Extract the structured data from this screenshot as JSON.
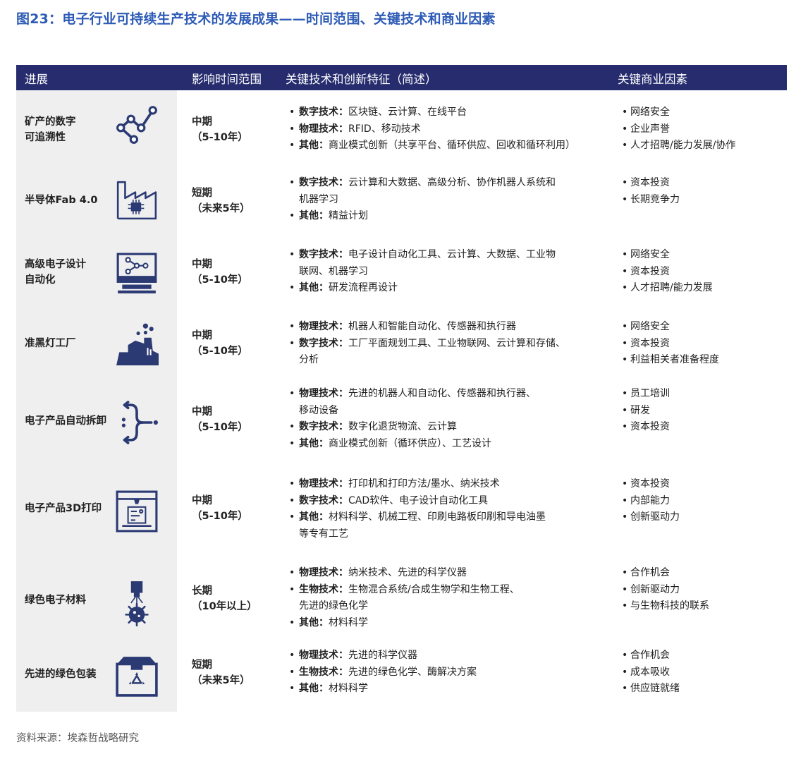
{
  "title": "图23：电子行业可持续生产技术的发展成果——时间范围、关键技术和商业因素",
  "header": {
    "col1": "进展",
    "col2": "影响时间范围",
    "col3": "关键技术和创新特征（简述）",
    "col4": "关键商业因素"
  },
  "rows": [
    {
      "name_l1": "矿产的数字",
      "name_l2": "可追溯性",
      "icon": "traceability-nodes-icon",
      "time_l1": "中期",
      "time_l2": "（5-10年）",
      "tech": [
        {
          "label": "数字技术：",
          "l1": "区块链、云计算、在线平台",
          "l2": ""
        },
        {
          "label": "物理技术：",
          "l1": "RFID、移动技术",
          "l2": ""
        },
        {
          "label": "其他：",
          "l1": "商业模式创新（共享平台、循环供应、回收和循环利用）",
          "l2": ""
        }
      ],
      "biz": [
        "网络安全",
        "企业声誉",
        "人才招聘/能力发展/协作"
      ]
    },
    {
      "name_l1": "半导体Fab 4.0",
      "name_l2": "",
      "icon": "factory-chip-icon",
      "time_l1": "短期",
      "time_l2": "（未来5年）",
      "tech": [
        {
          "label": "数字技术：",
          "l1": "云计算和大数据、高级分析、协作机器人系统和",
          "l2": "机器学习"
        },
        {
          "label": "其他：",
          "l1": "精益计划",
          "l2": ""
        }
      ],
      "biz": [
        "资本投资",
        "长期竞争力"
      ]
    },
    {
      "name_l1": "高级电子设计",
      "name_l2": "自动化",
      "icon": "monitor-network-icon",
      "time_l1": "中期",
      "time_l2": "（5-10年）",
      "tech": [
        {
          "label": "数字技术：",
          "l1": "电子设计自动化工具、云计算、大数据、工业物",
          "l2": "联网、机器学习"
        },
        {
          "label": "其他：",
          "l1": "研发流程再设计",
          "l2": ""
        }
      ],
      "biz": [
        "网络安全",
        "资本投资",
        "人才招聘/能力发展"
      ]
    },
    {
      "name_l1": "准黑灯工厂",
      "name_l2": "",
      "icon": "dark-factory-icon",
      "time_l1": "中期",
      "time_l2": "（5-10年）",
      "tech": [
        {
          "label": "物理技术：",
          "l1": "机器人和智能自动化、传感器和执行器",
          "l2": ""
        },
        {
          "label": "数字技术：",
          "l1": "工厂平面规划工具、工业物联网、云计算和存储、",
          "l2": "分析"
        }
      ],
      "biz": [
        "网络安全",
        "资本投资",
        "利益相关者准备程度"
      ]
    },
    {
      "name_l1": "电子产品自动拆卸",
      "name_l2": "",
      "icon": "disassembly-arrows-icon",
      "time_l1": "中期",
      "time_l2": "（5-10年）",
      "tech": [
        {
          "label": "物理技术：",
          "l1": "先进的机器人和自动化、传感器和执行器、",
          "l2": "移动设备"
        },
        {
          "label": "数字技术：",
          "l1": "数字化退货物流、云计算",
          "l2": ""
        },
        {
          "label": "其他：",
          "l1": "商业模式创新（循环供应）、工艺设计",
          "l2": ""
        }
      ],
      "biz": [
        "员工培训",
        "研发",
        "资本投资"
      ]
    },
    {
      "name_l1": "电子产品3D打印",
      "name_l2": "",
      "icon": "3d-printer-icon",
      "time_l1": "中期",
      "time_l2": "（5-10年）",
      "tech": [
        {
          "label": "物理技术：",
          "l1": "打印机和打印方法/墨水、纳米技术",
          "l2": ""
        },
        {
          "label": "数字技术：",
          "l1": "CAD软件、电子设计自动化工具",
          "l2": ""
        },
        {
          "label": "其他：",
          "l1": "材料科学、机械工程、印刷电路板印刷和导电油墨",
          "l2": "等专有工艺"
        }
      ],
      "biz": [
        "资本投资",
        "内部能力",
        "创新驱动力"
      ]
    },
    {
      "name_l1": "绿色电子材料",
      "name_l2": "",
      "icon": "bio-material-icon",
      "time_l1": "长期",
      "time_l2": "（10年以上）",
      "tech": [
        {
          "label": "物理技术：",
          "l1": "纳米技术、先进的科学仪器",
          "l2": ""
        },
        {
          "label": "生物技术：",
          "l1": "生物混合系统/合成生物学和生物工程、",
          "l2": "先进的绿色化学"
        },
        {
          "label": "其他：",
          "l1": "材料科学",
          "l2": ""
        }
      ],
      "biz": [
        "合作机会",
        "创新驱动力",
        "与生物科技的联系"
      ]
    },
    {
      "name_l1": "先进的绿色包装",
      "name_l2": "",
      "icon": "recycle-box-icon",
      "time_l1": "短期",
      "time_l2": "（未来5年）",
      "tech": [
        {
          "label": "物理技术：",
          "l1": "先进的科学仪器",
          "l2": ""
        },
        {
          "label": "生物技术：",
          "l1": "先进的绿色化学、酶解决方案",
          "l2": ""
        },
        {
          "label": "其他：",
          "l1": "材料科学",
          "l2": ""
        }
      ],
      "biz": [
        "合作机会",
        "成本吸收",
        "供应链就绪"
      ]
    }
  ],
  "source": "资料来源：埃森哲战略研究",
  "colors": {
    "title": "#2d5bb5",
    "header_bg": "#262c6e",
    "icon": "#2b3a73",
    "left_bg": "#efeff0"
  }
}
